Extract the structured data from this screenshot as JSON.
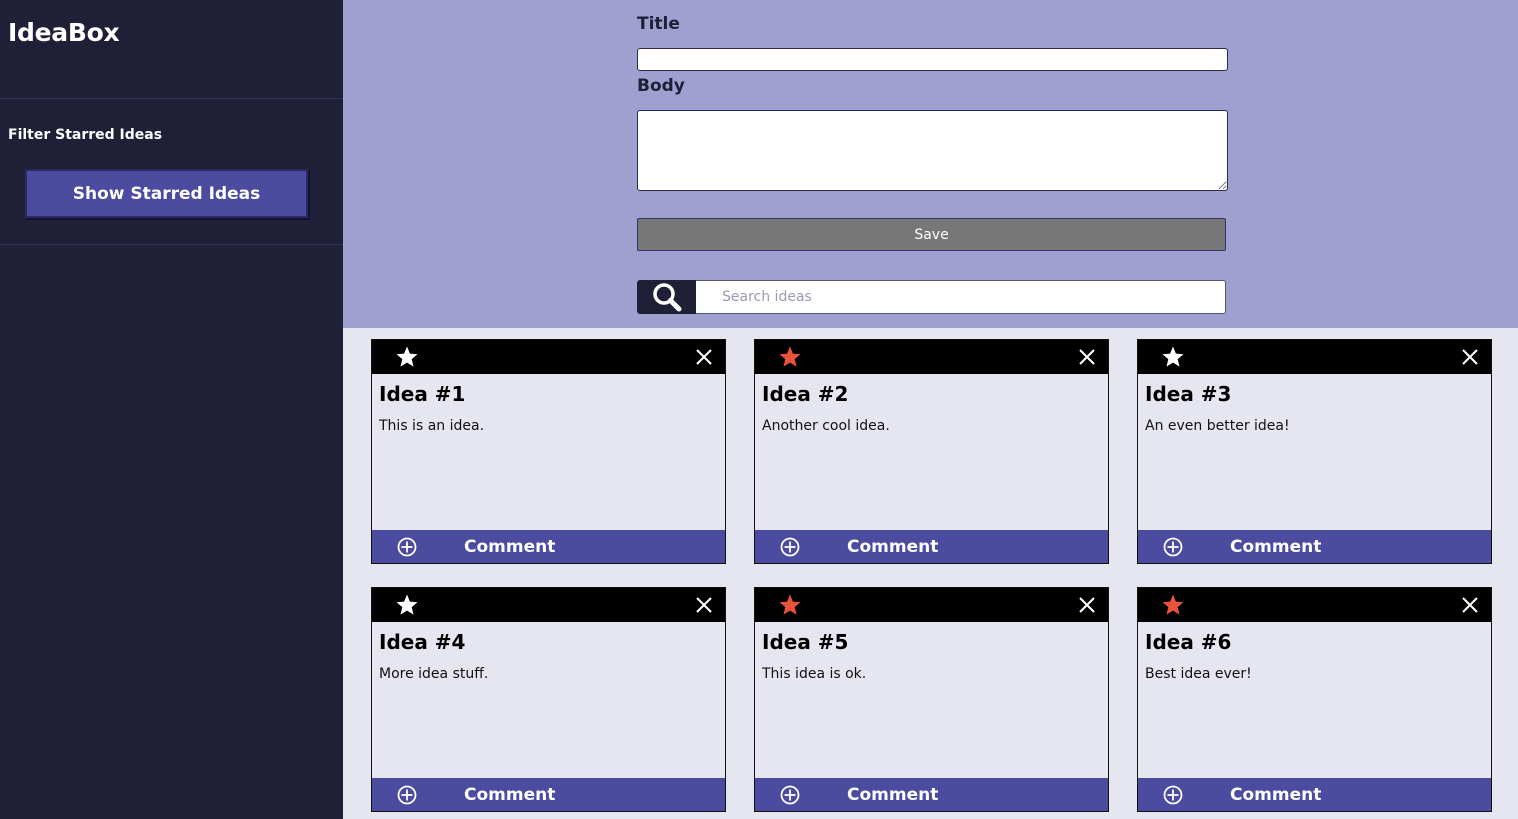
{
  "app": {
    "title": "IdeaBox"
  },
  "sidebar": {
    "filter_title": "Filter Starred Ideas",
    "show_starred_label": "Show Starred Ideas"
  },
  "form": {
    "title_label": "Title",
    "title_value": "",
    "body_label": "Body",
    "body_value": "",
    "save_label": "Save",
    "search_placeholder": "Search ideas",
    "search_value": ""
  },
  "colors": {
    "sidebar_bg": "#1f1f38",
    "form_bg": "#a0a0d0",
    "accent": "#4b4ba0",
    "star_active": "#e8533a",
    "star_inactive": "#ffffff"
  },
  "icons": {
    "search": "search-icon",
    "star": "star-icon",
    "close": "close-icon",
    "comment": "add-comment-icon"
  },
  "ideas": [
    {
      "title": "Idea #1",
      "body": "This is an idea.",
      "starred": false,
      "comment_label": "Comment"
    },
    {
      "title": "Idea #2",
      "body": "Another cool idea.",
      "starred": true,
      "comment_label": "Comment"
    },
    {
      "title": "Idea #3",
      "body": "An even better idea!",
      "starred": false,
      "comment_label": "Comment"
    },
    {
      "title": "Idea #4",
      "body": "More idea stuff.",
      "starred": false,
      "comment_label": "Comment"
    },
    {
      "title": "Idea #5",
      "body": "This idea is ok.",
      "starred": true,
      "comment_label": "Comment"
    },
    {
      "title": "Idea #6",
      "body": "Best idea ever!",
      "starred": true,
      "comment_label": "Comment"
    }
  ]
}
